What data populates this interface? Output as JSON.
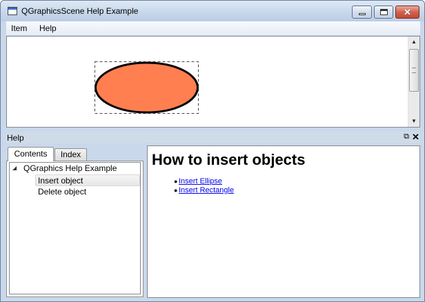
{
  "window": {
    "title": "QGraphicsScene Help Example",
    "controls": {
      "minimize": "minimize",
      "maximize": "maximize",
      "close": "✕"
    }
  },
  "menubar": {
    "items": [
      {
        "label": "Item"
      },
      {
        "label": "Help"
      }
    ]
  },
  "scene": {
    "ellipse_fill": "#ff7f50",
    "ellipse_stroke": "#000000",
    "selected": true
  },
  "help_dock": {
    "title": "Help",
    "float_icon": "⧉",
    "close_icon": "✕",
    "tabs": [
      {
        "label": "Contents",
        "active": true
      },
      {
        "label": "Index",
        "active": false
      }
    ],
    "tree": {
      "root": "QGraphics Help Example",
      "children": [
        {
          "label": "Insert object",
          "selected": true
        },
        {
          "label": "Delete object",
          "selected": false
        }
      ]
    }
  },
  "browser": {
    "heading": "How to insert objects",
    "links": [
      {
        "label": "Insert Ellipse"
      },
      {
        "label": "Insert Rectangle"
      }
    ]
  }
}
